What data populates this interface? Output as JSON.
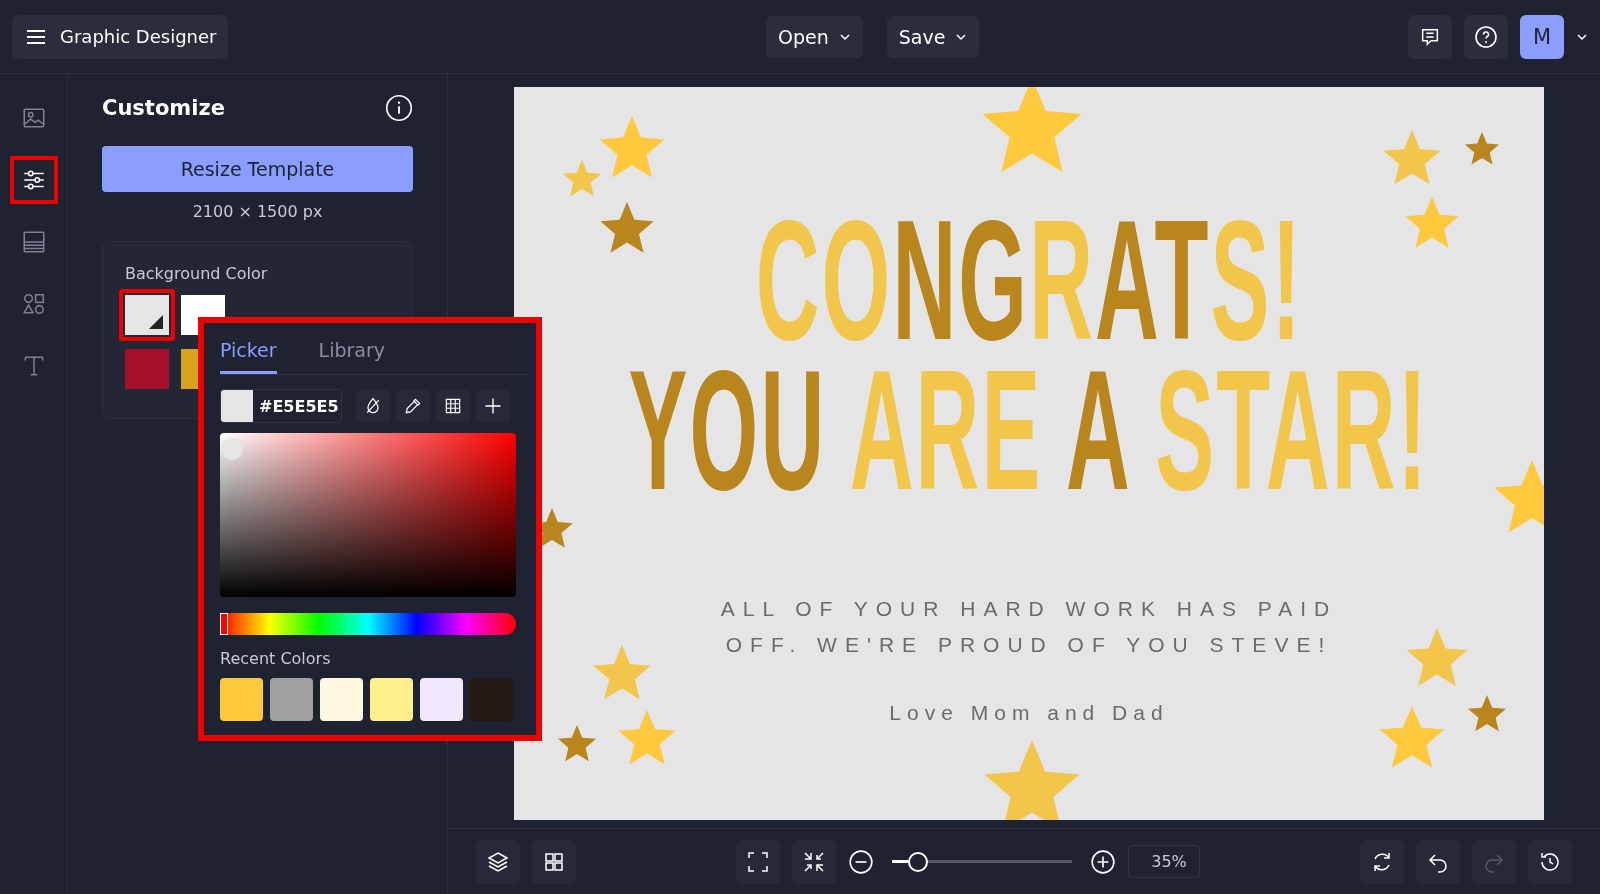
{
  "topbar": {
    "app_title": "Graphic Designer",
    "menus": [
      "Open",
      "Save"
    ],
    "avatar": "M"
  },
  "rail": [
    {
      "kind": "image",
      "selected": false,
      "highlighted": false
    },
    {
      "kind": "sliders",
      "selected": true,
      "highlighted": true
    },
    {
      "kind": "layout",
      "selected": false,
      "highlighted": false
    },
    {
      "kind": "shapes",
      "selected": false,
      "highlighted": false
    },
    {
      "kind": "text",
      "selected": false,
      "highlighted": false
    }
  ],
  "panel": {
    "title": "Customize",
    "resize_button": "Resize Template",
    "size": "2100 × 1500 px",
    "background_label": "Background Color",
    "swatches": [
      {
        "color": "#e5e5e5",
        "selected": true
      },
      {
        "color": "#ffffff",
        "selected": false
      },
      {
        "color": "#a50f2a",
        "selected": false
      },
      {
        "color": "#d9a21b",
        "selected": false
      }
    ]
  },
  "picker": {
    "highlighted": true,
    "tabs": [
      {
        "label": "Picker",
        "selected": true
      },
      {
        "label": "Library",
        "selected": false
      }
    ],
    "hex": "#E5E5E5",
    "hue": {
      "level": 0
    },
    "recent_label": "Recent Colors",
    "recent": [
      {
        "color": "#ffc83d"
      },
      {
        "color": "#a0a0a0"
      },
      {
        "color": "#fff8e1"
      },
      {
        "color": "#ffef8a"
      },
      {
        "color": "#f0e6ff"
      },
      {
        "color": "#231a16"
      }
    ]
  },
  "card": {
    "lines": [
      [
        {
          "text": "CO",
          "color": "#f2c54b"
        },
        {
          "text": "NG",
          "color": "#b8861d"
        },
        {
          "text": "R",
          "color": "#f2c54b"
        },
        {
          "text": "AT",
          "color": "#b8861d"
        },
        {
          "text": "S!",
          "color": "#f2c54b"
        }
      ],
      [
        {
          "text": "YOU ",
          "color": "#b8861d"
        },
        {
          "text": "ARE ",
          "color": "#f2c54b"
        },
        {
          "text": "A ",
          "color": "#b8861d"
        },
        {
          "text": "STAR!",
          "color": "#f2c54b"
        }
      ]
    ],
    "message": [
      "ALL OF YOUR HARD WORK HAS PAID",
      "OFF. WE'RE PROUD OF YOU STEVE!"
    ],
    "signature": "Love Mom and Dad"
  },
  "bottombar": {
    "zoom_slider": {
      "level": 0.1
    },
    "zoom": "35%"
  }
}
